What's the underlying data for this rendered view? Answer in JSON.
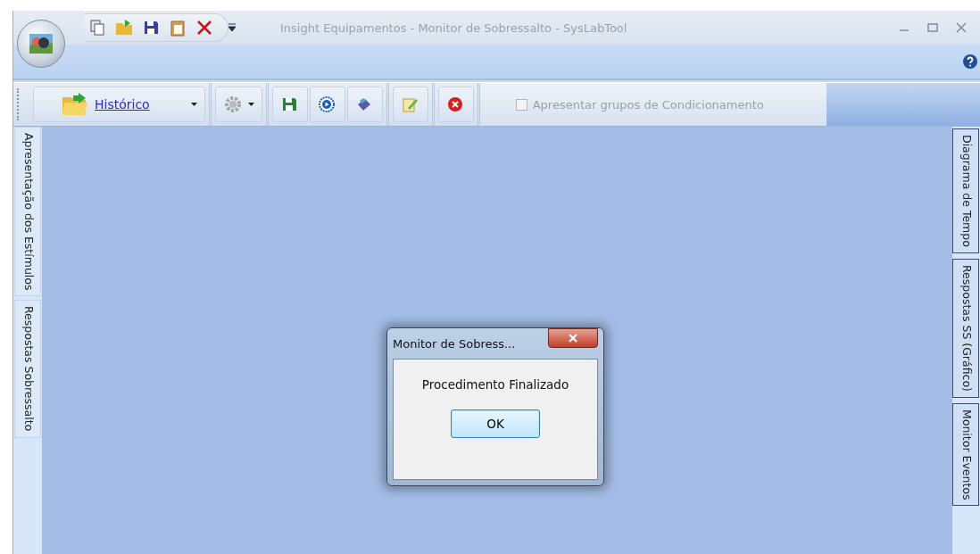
{
  "window": {
    "title": "Insight Equipamentos - Monitor de Sobressalto - SysLabTool"
  },
  "toolbar": {
    "history_button": {
      "label": "Histórico"
    },
    "checkbox": {
      "label": "Apresentar grupos de Condicionamento",
      "checked": false,
      "disabled": true
    }
  },
  "left_tabs": [
    {
      "label": "Apresentação dos Estímulos"
    },
    {
      "label": "Respostas Sobressalto"
    }
  ],
  "right_tabs": [
    {
      "label": "Diagrama de Tempo"
    },
    {
      "label": "Respostas SS (Gráfico)"
    },
    {
      "label": "Monitor Eventos"
    }
  ],
  "dialog": {
    "title": "Monitor de Sobress...",
    "message": "Procedimento Finalizado",
    "button": "OK"
  }
}
